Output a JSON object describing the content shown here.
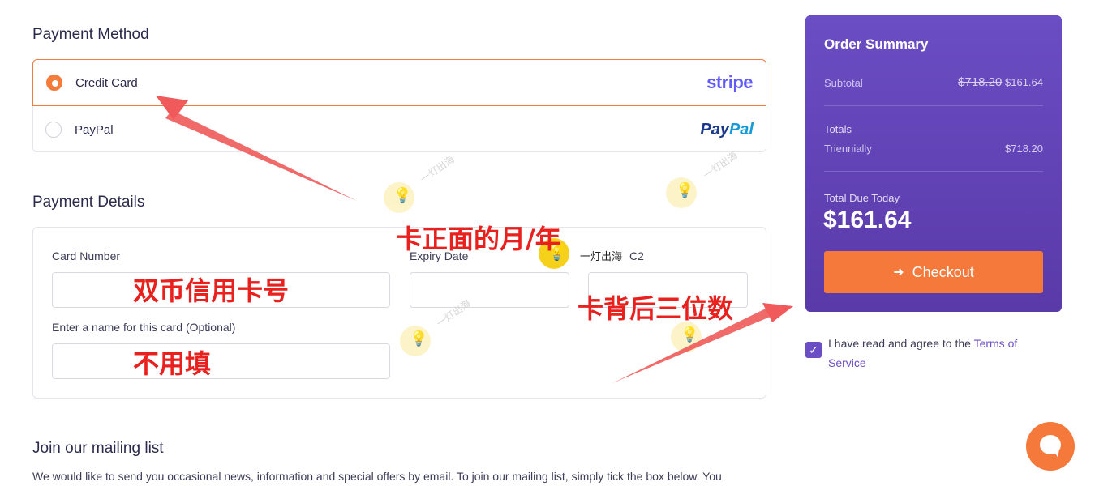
{
  "payment_method": {
    "title": "Payment Method",
    "options": [
      {
        "label": "Credit Card",
        "selected": true,
        "brand": "stripe"
      },
      {
        "label": "PayPal",
        "selected": false,
        "brand_a": "Pay",
        "brand_b": "Pal"
      }
    ]
  },
  "payment_details": {
    "title": "Payment Details",
    "card_number_label": "Card Number",
    "expiry_label": "Expiry Date",
    "cvc_label": "C2",
    "name_label": "Enter a name for this card (Optional)"
  },
  "mailing": {
    "title": "Join our mailing list",
    "text": "We would like to send you occasional news, information and special offers by email. To join our mailing list, simply tick the box below. You"
  },
  "order_summary": {
    "title": "Order Summary",
    "subtotal_label": "Subtotal",
    "subtotal_old": "$718.20",
    "subtotal_new": "$161.64",
    "totals_label": "Totals",
    "period_label": "Triennially",
    "period_value": "$718.20",
    "due_label": "Total Due Today",
    "due_amount": "$161.64",
    "checkout_label": "Checkout"
  },
  "agree": {
    "text": "I have read and agree to the",
    "link": "Terms of Service",
    "checked": true
  },
  "annotations": {
    "card_number": "双币信用卡号",
    "name": "不用填",
    "expiry": "卡正面的月/年",
    "cvc": "卡背后三位数",
    "watermark": "一灯出海"
  },
  "colors": {
    "accent": "#f47b3a",
    "summary_bg": "#5f40b3",
    "annotation": "#e8201e"
  }
}
